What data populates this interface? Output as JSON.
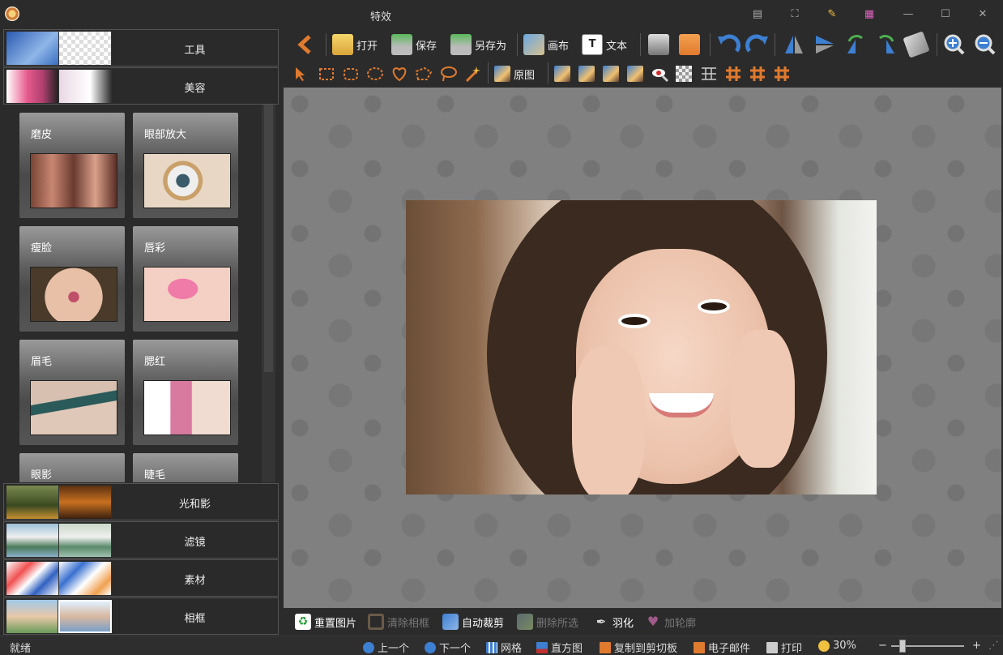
{
  "window": {
    "title": "特效"
  },
  "categories": [
    {
      "label": "工具"
    },
    {
      "label": "美容"
    },
    {
      "label": "光和影"
    },
    {
      "label": "滤镜"
    },
    {
      "label": "素材"
    },
    {
      "label": "相框"
    }
  ],
  "beauty_tiles": [
    {
      "label": "磨皮"
    },
    {
      "label": "眼部放大"
    },
    {
      "label": "瘦脸"
    },
    {
      "label": "唇彩"
    },
    {
      "label": "眉毛"
    },
    {
      "label": "腮红"
    },
    {
      "label": "眼影"
    },
    {
      "label": "睫毛"
    }
  ],
  "toolbar": {
    "open": "打开",
    "save": "保存",
    "save_as": "另存为",
    "canvas": "画布",
    "text": "文本",
    "original": "原图"
  },
  "action_bar": {
    "reset_image": "重置图片",
    "clear_frame": "清除相框",
    "auto_crop": "自动裁剪",
    "delete_selection": "删除所选",
    "feather": "羽化",
    "add_outline": "加轮廓"
  },
  "status_bar": {
    "status": "就绪",
    "prev": "上一个",
    "next": "下一个",
    "grid": "网格",
    "histogram": "直方图",
    "copy_clipboard": "复制到剪切板",
    "email": "电子邮件",
    "print": "打印",
    "zoom": "30%",
    "zoom_minus": "−",
    "zoom_plus": "+"
  },
  "colors": {
    "accent_orange": "#e07a2e",
    "accent_blue": "#3d7fd1",
    "panel_bg": "#2b2b2b",
    "canvas_bg": "#808080"
  }
}
